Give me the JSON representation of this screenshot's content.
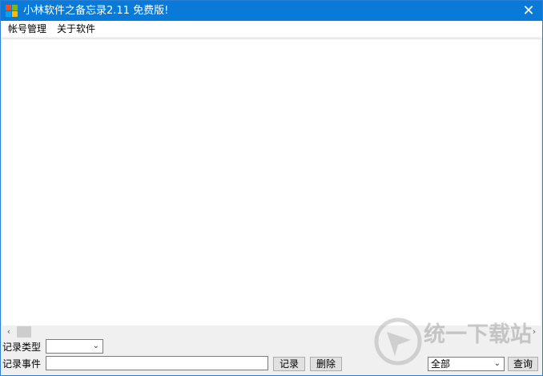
{
  "window": {
    "title": "小林软件之备忘录2.11  免费版!",
    "close_glyph": "✕"
  },
  "menu": {
    "items": [
      "帐号管理",
      "关于软件"
    ]
  },
  "scrollbar": {
    "left_arrow": "‹",
    "right_arrow": "›"
  },
  "form": {
    "record_type_label": "记录类型",
    "record_type_value": "",
    "record_event_label": "记录事件",
    "record_event_value": "",
    "record_button": "记录",
    "delete_button": "删除",
    "filter_value": "全部",
    "query_button": "查询"
  },
  "watermark": {
    "text": "统一下载站"
  },
  "colors": {
    "titlebar": "#0a7ad9",
    "accent_border": "#2b7fd6"
  }
}
